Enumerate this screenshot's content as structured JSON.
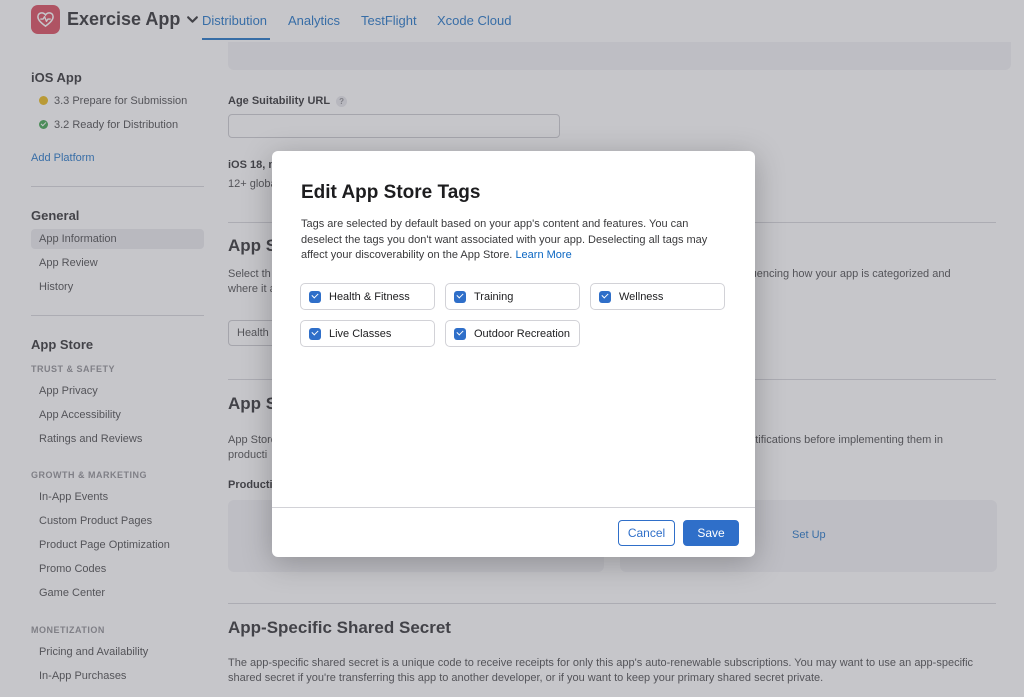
{
  "header": {
    "app_name": "Exercise App",
    "tabs": [
      {
        "label": "Distribution",
        "active": true
      },
      {
        "label": "Analytics"
      },
      {
        "label": "TestFlight"
      },
      {
        "label": "Xcode Cloud"
      }
    ]
  },
  "sidebar": {
    "platform_heading": "iOS App",
    "versions": [
      {
        "label": "3.3 Prepare for Submission",
        "status": "yellow"
      },
      {
        "label": "3.2 Ready for Distribution",
        "status": "green"
      }
    ],
    "add_platform": "Add Platform",
    "general_heading": "General",
    "general_items": [
      "App Information",
      "App Review",
      "History"
    ],
    "app_store_heading": "App Store",
    "trust_safety_label": "TRUST & SAFETY",
    "trust_items": [
      "App Privacy",
      "App Accessibility",
      "Ratings and Reviews"
    ],
    "growth_label": "GROWTH & MARKETING",
    "growth_items": [
      "In-App Events",
      "Custom Product Pages",
      "Product Page Optimization",
      "Promo Codes",
      "Game Center"
    ],
    "monetization_label": "MONETIZATION",
    "monetization_items": [
      "Pricing and Availability",
      "In-App Purchases"
    ]
  },
  "main": {
    "age_url_label": "Age Suitability URL",
    "help_glyph": "?",
    "ios_line": "iOS 18, m",
    "global_line": "12+ globa",
    "sec_app_s1": "App S",
    "select_text_a": "Select th",
    "select_text_b": "where it a",
    "select_text_right": "nfluencing how your app is categorized and",
    "health_field": "Health &",
    "sec_app_s2": "App S",
    "app_store_text_a": "App Store",
    "app_store_text_b": "producti",
    "notif_text": "notifications before implementing them in",
    "production_label": "Productio",
    "set_up": "Set Up",
    "shared_secret_title": "App-Specific Shared Secret",
    "shared_secret_body": "The app-specific shared secret is a unique code to receive receipts for only this app's auto-renewable subscriptions. You may want to use an app-specific shared secret if you're transferring this app to another developer, or if you want to keep your primary shared secret private."
  },
  "modal": {
    "title": "Edit App Store Tags",
    "description": "Tags are selected by default based on your app's content and features. You can deselect the tags you don't want associated with your app. Deselecting all tags may affect your discoverability on the App Store.",
    "learn_more": "Learn More",
    "tags": [
      {
        "label": "Health & Fitness",
        "checked": true
      },
      {
        "label": "Training",
        "checked": true
      },
      {
        "label": "Wellness",
        "checked": true
      },
      {
        "label": "Live Classes",
        "checked": true
      },
      {
        "label": "Outdoor Recreation",
        "checked": true
      }
    ],
    "cancel_label": "Cancel",
    "save_label": "Save"
  },
  "colors": {
    "accent": "#2f6fc9",
    "link": "#0a66c2",
    "app_icon": "#d83a4e",
    "status_yellow": "#e8b400",
    "status_green": "#2e9d3f"
  }
}
